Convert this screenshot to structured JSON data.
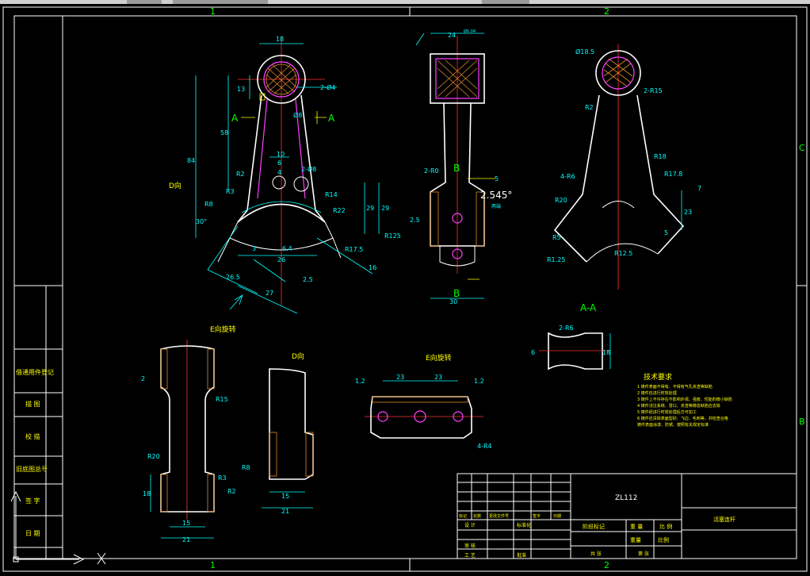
{
  "zones": {
    "top_1": "1",
    "top_2": "2",
    "bottom_1": "1",
    "bottom_2": "2",
    "right_c": "C",
    "right_b": "B"
  },
  "views": {
    "section_mark_left": "A",
    "section_mark_right": "A",
    "section_title": "A-A",
    "view_b_top": "B",
    "view_b_bottom": "B",
    "d_view_label": "D向",
    "e_rot_label_1": "E向旋转",
    "e_rot_label_2": "E向旋转",
    "d_view_label_2": "D向"
  },
  "dimensions": {
    "front": [
      "18",
      "13",
      "58",
      "84",
      "2-Ø4",
      "Ø8",
      "2-Ø8",
      "10",
      "6",
      "4",
      "R3",
      "R2",
      "R8",
      "R14",
      "R22",
      "29",
      "29",
      "30°",
      "26",
      "6.4",
      "26.5",
      "27",
      "R17.5",
      "2.5",
      "16",
      "R125",
      "3"
    ],
    "side": [
      "24",
      "Ø0.04",
      "2.545°",
      "两端",
      "2-R0",
      "2.5",
      "5",
      "30",
      "B"
    ],
    "right": [
      "Ø18.5",
      "2-R15",
      "R2",
      "R18",
      "R17.8",
      "4-R6",
      "R20",
      "R5",
      "R1.25",
      "R12.5",
      "23",
      "5",
      "7"
    ],
    "lower": [
      "2",
      "R15",
      "R20",
      "18",
      "15",
      "21",
      "R3",
      "R2",
      "R8",
      "15",
      "21",
      "1.2",
      "1.2",
      "23",
      "23",
      "4-R4",
      "2-R6",
      "6",
      "18"
    ]
  },
  "technical_requirements": {
    "title": "技术要求",
    "items": [
      "1 铸件表面不得有、不得有气孔夹渣等缺陷",
      "2 铸件应进行时效处理",
      "3 铸件上不许存在不影响外观、强度、性能的微小缺陷",
      "4 铸件浇注系统、冒口、夹渣等铸造缺陷应去除",
      "5 铸件经进行时效处理后方可加工",
      "6 铸件应清除表面型砂、飞边、毛刺等，并检查合格",
      "铸件表面涂漆、防锈、按照有关规定标准"
    ]
  },
  "side_stamp": {
    "rows": [
      "借通用件登记",
      "描 图",
      "校 描",
      "旧底图总号",
      "签 字",
      "日 期"
    ]
  },
  "title_block": {
    "part_code": "ZL112",
    "drawing_name": "活塞连杆",
    "header_cols": [
      "标记",
      "处数",
      "更改文件号",
      "签字",
      "日期"
    ],
    "designer": "设 计",
    "standardization": "标准化",
    "audit": "审 核",
    "process": "工 艺",
    "approve": "批准",
    "stage_mark": "阶段标记",
    "weight": "重 量",
    "scale": "比 例",
    "scale_label": "比例",
    "mass": "重量",
    "sheet_total": "共 张",
    "sheet_no": "第 张"
  },
  "colors": {
    "background": "#000000",
    "outline": "#ffffff",
    "dimension": "#00ffff",
    "centerline": "#ff3030",
    "section_mark": "#00ff00",
    "text": "#ffff00",
    "bushing": "#ff40ff",
    "hatch": "#e08a2a"
  },
  "icons": {
    "ucs": "ucs-axis-icon"
  }
}
